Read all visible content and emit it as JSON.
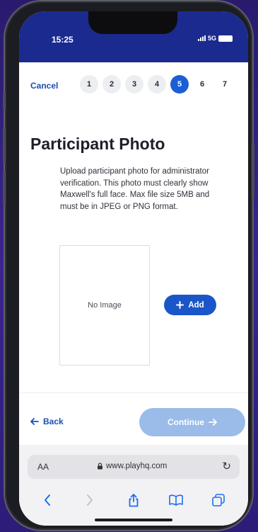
{
  "status": {
    "time": "15:25",
    "network": "5G"
  },
  "stepper": {
    "cancel_label": "Cancel",
    "steps": [
      "1",
      "2",
      "3",
      "4",
      "5",
      "6",
      "7"
    ],
    "current_step": "5"
  },
  "page": {
    "title": "Participant Photo",
    "description": "Upload participant photo for administrator verification. This photo must clearly show Maxwell's full face. Max file size 5MB and must be in JPEG or PNG format."
  },
  "photo": {
    "placeholder_label": "No Image",
    "add_label": "Add",
    "add_icon": "plus-icon"
  },
  "footer": {
    "back_label": "Back",
    "continue_label": "Continue"
  },
  "browser": {
    "text_size_label": "AA",
    "url": "www.playhq.com"
  },
  "colors": {
    "status_bar": "#1b2a8e",
    "primary": "#1b56c9",
    "active_step": "#1b5fd6",
    "disabled_button": "#9bbce8"
  }
}
